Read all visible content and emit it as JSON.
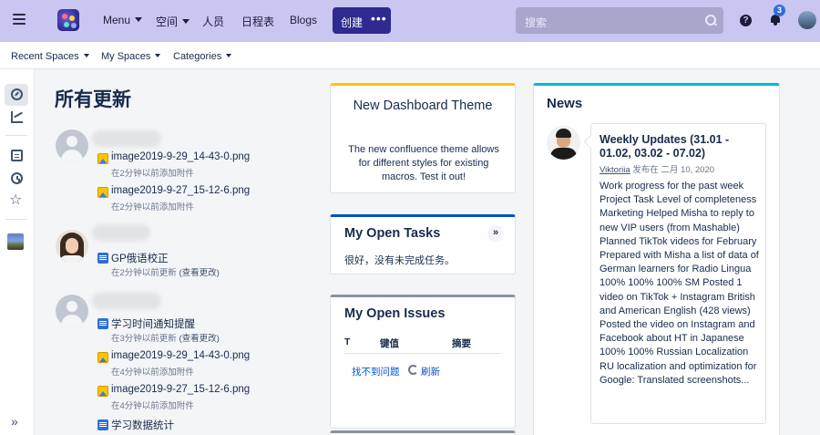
{
  "topbar": {
    "menu_label": "Menu",
    "spaces_label": "空间",
    "people_label": "人员",
    "calendar_label": "日程表",
    "blogs_label": "Blogs",
    "create_label": "创建",
    "create_more": "•••",
    "search_placeholder": "搜索",
    "help_glyph": "?",
    "notification_count": "3"
  },
  "spacebar": {
    "recent_spaces": "Recent Spaces",
    "my_spaces": "My Spaces",
    "categories": "Categories"
  },
  "rail": {
    "icons": [
      "compass-icon",
      "chart-icon",
      "page-icon",
      "clock-icon",
      "star-icon",
      "space-avatar",
      "expand-icon"
    ],
    "star_glyph": "☆",
    "expand_glyph": "»"
  },
  "feed": {
    "title": "所有更新",
    "groups": [
      {
        "items": [
          {
            "title": "image2019-9-29_14-43-0.png",
            "meta": "在2分钟以前添加附件"
          },
          {
            "title": "image2019-9-27_15-12-6.png",
            "meta": "在2分钟以前添加附件"
          }
        ]
      },
      {
        "items": [
          {
            "title": "GP俄语校正",
            "meta": "在2分钟以前更新",
            "link": "(查看更改)"
          }
        ]
      },
      {
        "items": [
          {
            "title": "学习时间通知提醒",
            "meta": "在3分钟以前更新",
            "link": "(查看更改)"
          },
          {
            "title": "image2019-9-29_14-43-0.png",
            "meta": "在4分钟以前添加附件"
          },
          {
            "title": "image2019-9-27_15-12-6.png",
            "meta": "在4分钟以前添加附件"
          },
          {
            "title": "学习数据统计"
          }
        ]
      }
    ]
  },
  "theme_card": {
    "title": "New Dashboard Theme",
    "description": "The new confluence theme allows for different styles for existing macros. Test it out!"
  },
  "tasks_card": {
    "title": "My Open Tasks",
    "toggle": "»",
    "empty_text": "很好，没有未完成任务。"
  },
  "issues_card": {
    "title": "My Open Issues",
    "columns": [
      "T",
      "键值",
      "摘要"
    ],
    "not_found": "找不到问题",
    "refresh": "刷新"
  },
  "news": {
    "title": "News",
    "post_title": "Weekly Updates (31.01 - 01.02, 03.02 - 07.02)",
    "author": "Viktoriia",
    "published": "发布在 二月 10, 2020",
    "body": "Work progress for the past week Project Task Level of completeness Marketing Helped Misha to reply to new VIP users (from Mashable) Planned TikTok videos for February Prepared with Misha a list of data of German learners for  Radio Lingua 100% 100% 100% SM Posted 1 video on TikTok + Instagram British and American English (428 views) Posted the video on Instagram and Facebook about HT in Japanese 100% 100% Russian Localization RU localization and optimization for Google: Translated screenshots..."
  },
  "colors": {
    "topbar_bg": "#c9c6f1",
    "create_button": "#2e2a8f",
    "link": "#0052cc",
    "theme_accent": "#ffc400",
    "tasks_accent": "#0052cc",
    "news_accent": "#00b8d9"
  }
}
